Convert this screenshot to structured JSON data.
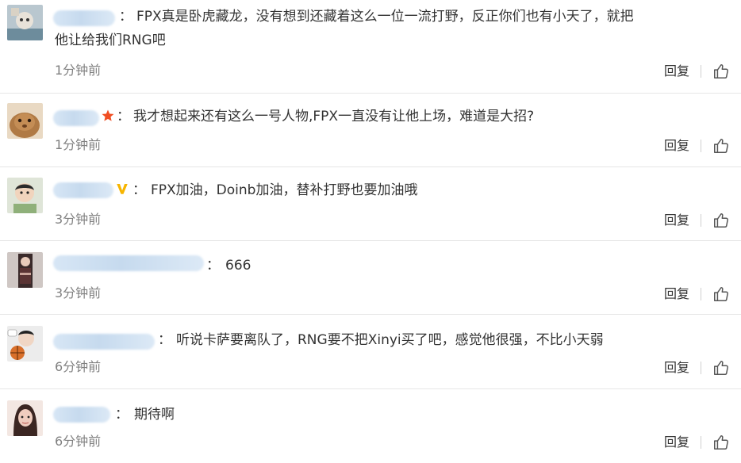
{
  "comments": [
    {
      "text": "FPX真是卧虎藏龙，没有想到还藏着这么一位一流打野，反正你们也有小天了，就把他让给我们RNG吧",
      "colon": "：",
      "time": "1分钟前",
      "reply": "回复",
      "badge": "",
      "avatar": "avatar-cartoon"
    },
    {
      "text": "我才想起来还有这么一号人物,FPX一直没有让他上场，难道是大招?",
      "colon": "：",
      "time": "1分钟前",
      "reply": "回复",
      "badge": "star-icon",
      "avatar": "avatar-rabbit"
    },
    {
      "text": "FPX加油，Doinb加油，替补打野也要加油哦",
      "colon": "：",
      "time": "3分钟前",
      "reply": "回复",
      "badge": "v-badge-icon",
      "avatar": "avatar-child"
    },
    {
      "text": "666",
      "colon": "：",
      "time": "3分钟前",
      "reply": "回复",
      "badge": "",
      "avatar": "avatar-woman"
    },
    {
      "text": "听说卡萨要离队了，RNG要不把Xinyi买了吧，感觉他很强，不比小天弱",
      "colon": "：",
      "time": "6分钟前",
      "reply": "回复",
      "badge": "",
      "avatar": "avatar-basketball"
    },
    {
      "text": "期待啊",
      "colon": "：",
      "time": "6分钟前",
      "reply": "回复",
      "badge": "",
      "avatar": "avatar-girl"
    }
  ],
  "colors": {
    "separator": "#e6e6e6",
    "time": "#808080",
    "text": "#333333",
    "star": "#f04e23",
    "v_badge": "#f7b500"
  }
}
